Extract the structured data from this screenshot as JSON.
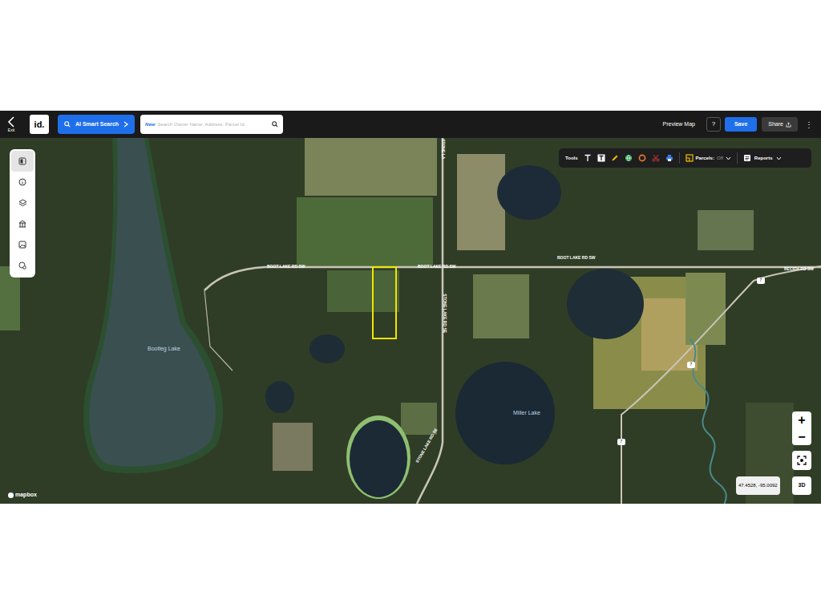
{
  "toolbar": {
    "exit": "Exit",
    "logo": "id.",
    "ai_search": "AI Smart Search",
    "search": {
      "badge": "New",
      "placeholder": "Search Owner Name, Address, Parcel Id"
    },
    "preview": "Preview Map",
    "help": "?",
    "save": "Save",
    "share": "Share",
    "more": "⋮"
  },
  "tools": {
    "label": "Tools",
    "parcels": {
      "label": "Parcels:",
      "value": "Off"
    },
    "reports": "Reports"
  },
  "map": {
    "roads": [
      "BOOT LAKE RD SW",
      "BOOT LAKE RD SW",
      "BOOT LAKE RD SW",
      "STONE LA",
      "STONE LAKE RD SE",
      "STONE LAKE RD SE",
      "BECIDA RD SW"
    ],
    "lakes": [
      "Bootleg Lake",
      "Miller Lake"
    ],
    "shields": [
      "7",
      "7",
      "7"
    ],
    "attribution": "mapbox",
    "coordinates": "47.4528, -95.0092"
  },
  "controls": {
    "zoom_in": "+",
    "zoom_out": "−",
    "view_3d": "3D"
  }
}
